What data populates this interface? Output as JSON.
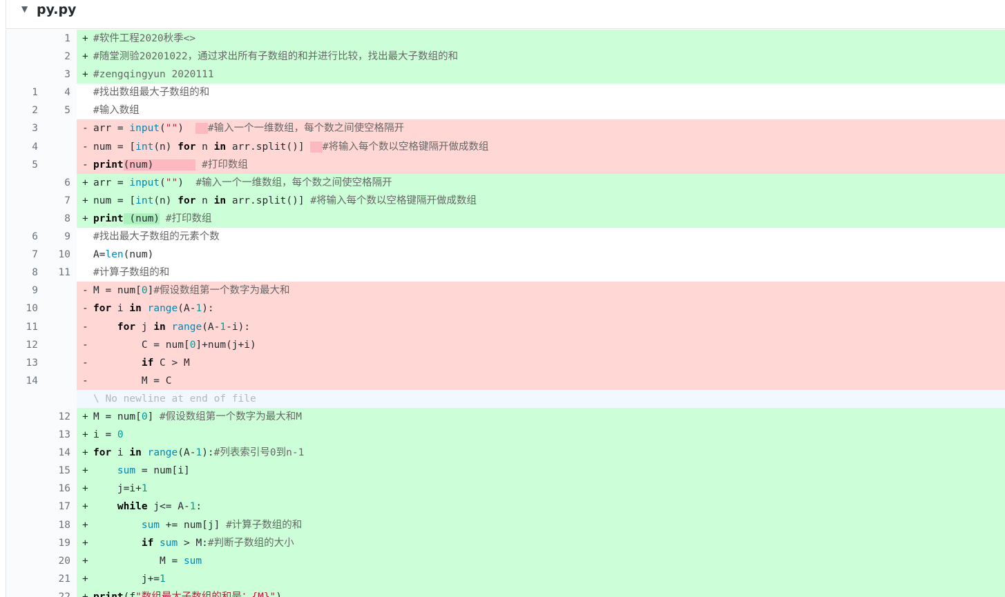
{
  "file": {
    "name": "py.py"
  },
  "diff_lines": [
    {
      "type": "add",
      "old": "",
      "new": "1",
      "sign": "+",
      "segs": [
        {
          "t": "#软件工程2020秋季<>",
          "c": "cm"
        }
      ]
    },
    {
      "type": "add",
      "old": "",
      "new": "2",
      "sign": "+",
      "segs": [
        {
          "t": "#随堂测验20201022，通过求出所有子数组的和并进行比较，找出最大子数组的和",
          "c": "cm"
        }
      ]
    },
    {
      "type": "add",
      "old": "",
      "new": "3",
      "sign": "+",
      "segs": [
        {
          "t": "#zengqingyun 2020111",
          "c": "cm"
        }
      ]
    },
    {
      "type": "ctx",
      "old": "1",
      "new": "4",
      "sign": " ",
      "segs": [
        {
          "t": "#找出数组最大子数组的和",
          "c": "cm"
        }
      ]
    },
    {
      "type": "ctx",
      "old": "2",
      "new": "5",
      "sign": " ",
      "segs": [
        {
          "t": "#输入数组",
          "c": "cm"
        }
      ]
    },
    {
      "type": "del",
      "old": "3",
      "new": "",
      "sign": "-",
      "segs": [
        {
          "t": "arr = "
        },
        {
          "t": "input",
          "c": "bi"
        },
        {
          "t": "("
        },
        {
          "t": "\"\"",
          "c": "str"
        },
        {
          "t": ")  "
        },
        {
          "t": "  ",
          "c": "hl-del"
        },
        {
          "t": "#输入一个一维数组，每个数之间使空格隔开",
          "c": "cm"
        }
      ]
    },
    {
      "type": "del",
      "old": "4",
      "new": "",
      "sign": "-",
      "segs": [
        {
          "t": "num = ["
        },
        {
          "t": "int",
          "c": "bi"
        },
        {
          "t": "(n) "
        },
        {
          "t": "for",
          "c": "kw"
        },
        {
          "t": " n "
        },
        {
          "t": "in",
          "c": "kw"
        },
        {
          "t": " arr.split()] "
        },
        {
          "t": "  ",
          "c": "hl-del"
        },
        {
          "t": "#将输入每个数以空格键隔开做成数组",
          "c": "cm"
        }
      ]
    },
    {
      "type": "del",
      "old": "5",
      "new": "",
      "sign": "-",
      "segs": [
        {
          "t": "print",
          "c": "kw"
        },
        {
          "t": "(num)       ",
          "c": "hl-del"
        },
        {
          "t": " "
        },
        {
          "t": "#打印数组",
          "c": "cm"
        }
      ]
    },
    {
      "type": "add",
      "old": "",
      "new": "6",
      "sign": "+",
      "segs": [
        {
          "t": "arr = "
        },
        {
          "t": "input",
          "c": "bi"
        },
        {
          "t": "("
        },
        {
          "t": "\"\"",
          "c": "str"
        },
        {
          "t": ")  "
        },
        {
          "t": "#输入一个一维数组，每个数之间使空格隔开",
          "c": "cm"
        }
      ]
    },
    {
      "type": "add",
      "old": "",
      "new": "7",
      "sign": "+",
      "segs": [
        {
          "t": "num = ["
        },
        {
          "t": "int",
          "c": "bi"
        },
        {
          "t": "(n) "
        },
        {
          "t": "for",
          "c": "kw"
        },
        {
          "t": " n "
        },
        {
          "t": "in",
          "c": "kw"
        },
        {
          "t": " arr.split()] "
        },
        {
          "t": "#将输入每个数以空格键隔开做成数组",
          "c": "cm"
        }
      ]
    },
    {
      "type": "add",
      "old": "",
      "new": "8",
      "sign": "+",
      "segs": [
        {
          "t": "print",
          "c": "kw"
        },
        {
          "t": " (num)",
          "c": "hl-add"
        },
        {
          "t": " "
        },
        {
          "t": "#打印数组",
          "c": "cm"
        }
      ]
    },
    {
      "type": "ctx",
      "old": "6",
      "new": "9",
      "sign": " ",
      "segs": [
        {
          "t": "#找出最大子数组的元素个数",
          "c": "cm"
        }
      ]
    },
    {
      "type": "ctx",
      "old": "7",
      "new": "10",
      "sign": " ",
      "segs": [
        {
          "t": "A="
        },
        {
          "t": "len",
          "c": "bi"
        },
        {
          "t": "(num)"
        }
      ]
    },
    {
      "type": "ctx",
      "old": "8",
      "new": "11",
      "sign": " ",
      "segs": [
        {
          "t": "#计算子数组的和",
          "c": "cm"
        }
      ]
    },
    {
      "type": "del",
      "old": "9",
      "new": "",
      "sign": "-",
      "segs": [
        {
          "t": "M = num["
        },
        {
          "t": "0",
          "c": "num"
        },
        {
          "t": "]"
        },
        {
          "t": "#假设数组第一个数字为最大和",
          "c": "cm"
        }
      ]
    },
    {
      "type": "del",
      "old": "10",
      "new": "",
      "sign": "-",
      "segs": [
        {
          "t": "for",
          "c": "kw"
        },
        {
          "t": " i "
        },
        {
          "t": "in",
          "c": "kw"
        },
        {
          "t": " "
        },
        {
          "t": "range",
          "c": "bi"
        },
        {
          "t": "(A-"
        },
        {
          "t": "1",
          "c": "num"
        },
        {
          "t": "):"
        }
      ]
    },
    {
      "type": "del",
      "old": "11",
      "new": "",
      "sign": "-",
      "segs": [
        {
          "t": "    "
        },
        {
          "t": "for",
          "c": "kw"
        },
        {
          "t": " j "
        },
        {
          "t": "in",
          "c": "kw"
        },
        {
          "t": " "
        },
        {
          "t": "range",
          "c": "bi"
        },
        {
          "t": "(A-"
        },
        {
          "t": "1",
          "c": "num"
        },
        {
          "t": "-i):"
        }
      ]
    },
    {
      "type": "del",
      "old": "12",
      "new": "",
      "sign": "-",
      "segs": [
        {
          "t": "        C = num["
        },
        {
          "t": "0",
          "c": "num"
        },
        {
          "t": "]+num(j+i)"
        }
      ]
    },
    {
      "type": "del",
      "old": "13",
      "new": "",
      "sign": "-",
      "segs": [
        {
          "t": "        "
        },
        {
          "t": "if",
          "c": "kw"
        },
        {
          "t": " C > M"
        }
      ]
    },
    {
      "type": "del",
      "old": "14",
      "new": "",
      "sign": "-",
      "segs": [
        {
          "t": "        M = C"
        }
      ]
    },
    {
      "type": "nonl",
      "old": "",
      "new": "",
      "sign": " ",
      "segs": [
        {
          "t": "\\ No newline at end of file",
          "c": "nonl-text"
        }
      ]
    },
    {
      "type": "add",
      "old": "",
      "new": "12",
      "sign": "+",
      "segs": [
        {
          "t": "M = num["
        },
        {
          "t": "0",
          "c": "num"
        },
        {
          "t": "] "
        },
        {
          "t": "#假设数组第一个数字为最大和M",
          "c": "cm"
        }
      ]
    },
    {
      "type": "add",
      "old": "",
      "new": "13",
      "sign": "+",
      "segs": [
        {
          "t": "i = "
        },
        {
          "t": "0",
          "c": "num"
        }
      ]
    },
    {
      "type": "add",
      "old": "",
      "new": "14",
      "sign": "+",
      "segs": [
        {
          "t": "for",
          "c": "kw"
        },
        {
          "t": " i "
        },
        {
          "t": "in",
          "c": "kw"
        },
        {
          "t": " "
        },
        {
          "t": "range",
          "c": "bi"
        },
        {
          "t": "(A-"
        },
        {
          "t": "1",
          "c": "num"
        },
        {
          "t": "):"
        },
        {
          "t": "#列表索引号0到n-1",
          "c": "cm"
        }
      ]
    },
    {
      "type": "add",
      "old": "",
      "new": "15",
      "sign": "+",
      "segs": [
        {
          "t": "    "
        },
        {
          "t": "sum",
          "c": "bi"
        },
        {
          "t": " = num[i]"
        }
      ]
    },
    {
      "type": "add",
      "old": "",
      "new": "16",
      "sign": "+",
      "segs": [
        {
          "t": "    j=i+"
        },
        {
          "t": "1",
          "c": "num"
        }
      ]
    },
    {
      "type": "add",
      "old": "",
      "new": "17",
      "sign": "+",
      "segs": [
        {
          "t": "    "
        },
        {
          "t": "while",
          "c": "kw"
        },
        {
          "t": " j<= A-"
        },
        {
          "t": "1",
          "c": "num"
        },
        {
          "t": ":"
        }
      ]
    },
    {
      "type": "add",
      "old": "",
      "new": "18",
      "sign": "+",
      "segs": [
        {
          "t": "        "
        },
        {
          "t": "sum",
          "c": "bi"
        },
        {
          "t": " += num[j] "
        },
        {
          "t": "#计算子数组的和",
          "c": "cm"
        }
      ]
    },
    {
      "type": "add",
      "old": "",
      "new": "19",
      "sign": "+",
      "segs": [
        {
          "t": "        "
        },
        {
          "t": "if",
          "c": "kw"
        },
        {
          "t": " "
        },
        {
          "t": "sum",
          "c": "bi"
        },
        {
          "t": " > M:"
        },
        {
          "t": "#判断子数组的大小",
          "c": "cm"
        }
      ]
    },
    {
      "type": "add",
      "old": "",
      "new": "20",
      "sign": "+",
      "segs": [
        {
          "t": "           M = "
        },
        {
          "t": "sum",
          "c": "bi"
        }
      ]
    },
    {
      "type": "add",
      "old": "",
      "new": "21",
      "sign": "+",
      "segs": [
        {
          "t": "        j+="
        },
        {
          "t": "1",
          "c": "num"
        }
      ]
    },
    {
      "type": "add",
      "old": "",
      "new": "22",
      "sign": "+",
      "segs": [
        {
          "t": "print",
          "c": "kw"
        },
        {
          "t": "(f"
        },
        {
          "t": "\"数组最大子数组的和是：{M}\"",
          "c": "str"
        },
        {
          "t": ")"
        }
      ]
    }
  ]
}
